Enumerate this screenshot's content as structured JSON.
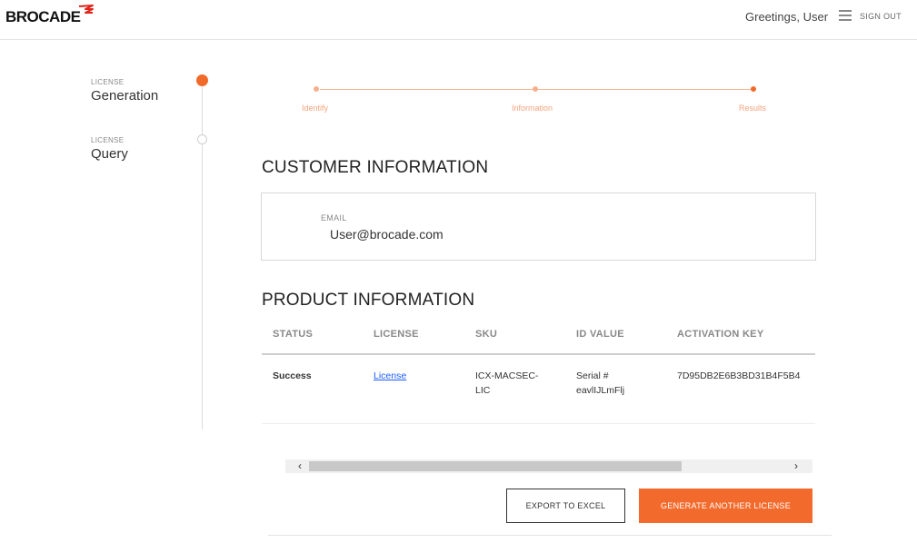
{
  "header": {
    "logo_text": "BROCADE",
    "greeting": "Greetings, User",
    "signout": "SIGN OUT",
    "menu_icon": "hamburger-icon",
    "accent_color": "#f06b2a"
  },
  "nav": {
    "items": [
      {
        "small": "LICENSE",
        "big": "Generation",
        "active": true
      },
      {
        "small": "LICENSE",
        "big": "Query",
        "active": false
      }
    ]
  },
  "stepper": {
    "steps": [
      {
        "label": "Identify",
        "state": "done"
      },
      {
        "label": "Information",
        "state": "done"
      },
      {
        "label": "Results",
        "state": "current"
      }
    ]
  },
  "customer": {
    "title": "CUSTOMER INFORMATION",
    "email_label": "EMAIL",
    "email_value": "User@brocade.com"
  },
  "product": {
    "title": "PRODUCT INFORMATION",
    "columns": [
      "STATUS",
      "LICENSE",
      "SKU",
      "ID VALUE",
      "ACTIVATION KEY"
    ],
    "rows": [
      {
        "status": "Success",
        "license": "License",
        "sku_line1": "ICX-MACSEC-",
        "sku_line2": "LIC",
        "id_line1": "Serial #",
        "id_line2": "eavlIJLmFlj",
        "activation_key": "7D95DB2E6B3BD31B4F5B4"
      }
    ]
  },
  "scroll": {
    "left_arrow": "‹",
    "right_arrow": "›",
    "position_fraction": 0
  },
  "actions": {
    "export_label": "EXPORT TO EXCEL",
    "generate_label": "GENERATE ANOTHER LICENSE"
  }
}
